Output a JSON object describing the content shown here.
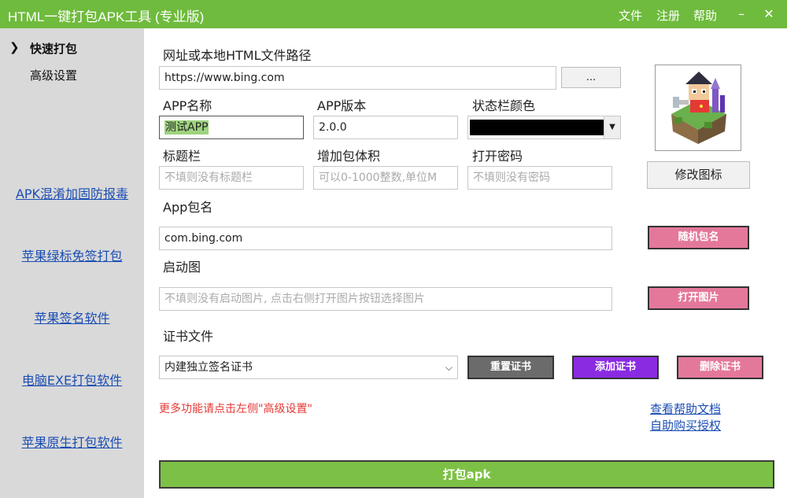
{
  "app": {
    "title": "HTML一键打包APK工具 (专业版)",
    "menu": [
      "文件",
      "注册",
      "帮助"
    ],
    "window_buttons": {
      "minimize": "–",
      "close": "✕"
    }
  },
  "sidebar": {
    "nav": [
      {
        "label": "快速打包",
        "active": true,
        "chevron": "❯"
      },
      {
        "label": "高级设置",
        "active": false
      }
    ],
    "links": [
      "APK混淆加固防报毒",
      "苹果绿标免签打包",
      "苹果签名软件",
      "电脑EXE打包软件",
      "苹果原生打包软件"
    ]
  },
  "form": {
    "url_label": "网址或本地HTML文件路径",
    "url_value": "https://www.bing.com",
    "browse_label": "...",
    "app_name_label": "APP名称",
    "app_name_value": "测试APP",
    "app_version_label": "APP版本",
    "app_version_value": "2.0.0",
    "status_bar_label": "状态栏颜色",
    "status_bar_color": "#000000",
    "title_bar_label": "标题栏",
    "title_bar_placeholder": "不填则没有标题栏",
    "size_label": "增加包体积",
    "size_placeholder": "可以0-1000整数,单位M",
    "password_label": "打开密码",
    "password_placeholder": "不填则没有密码",
    "package_label": "App包名",
    "package_value": "com.bing.com",
    "random_package_label": "随机包名",
    "splash_label": "启动图",
    "splash_placeholder": "不填则没有启动图片, 点击右侧打开图片按钮选择图片",
    "open_image_label": "打开图片",
    "cert_label": "证书文件",
    "cert_selected": "内建独立签名证书",
    "reset_cert_label": "重置证书",
    "add_cert_label": "添加证书",
    "delete_cert_label": "删除证书",
    "change_icon_label": "修改图标"
  },
  "note": "更多功能请点击左侧\"高级设置\"",
  "help_links": [
    "查看帮助文档",
    "自助购买授权"
  ],
  "pack_button": "打包apk",
  "colors": {
    "accent": "#6fbb3d",
    "pink": "#e4789a",
    "purple": "#8a2be2",
    "gray": "#6b6b6b",
    "link": "#1a4db3",
    "note": "#e53935"
  }
}
